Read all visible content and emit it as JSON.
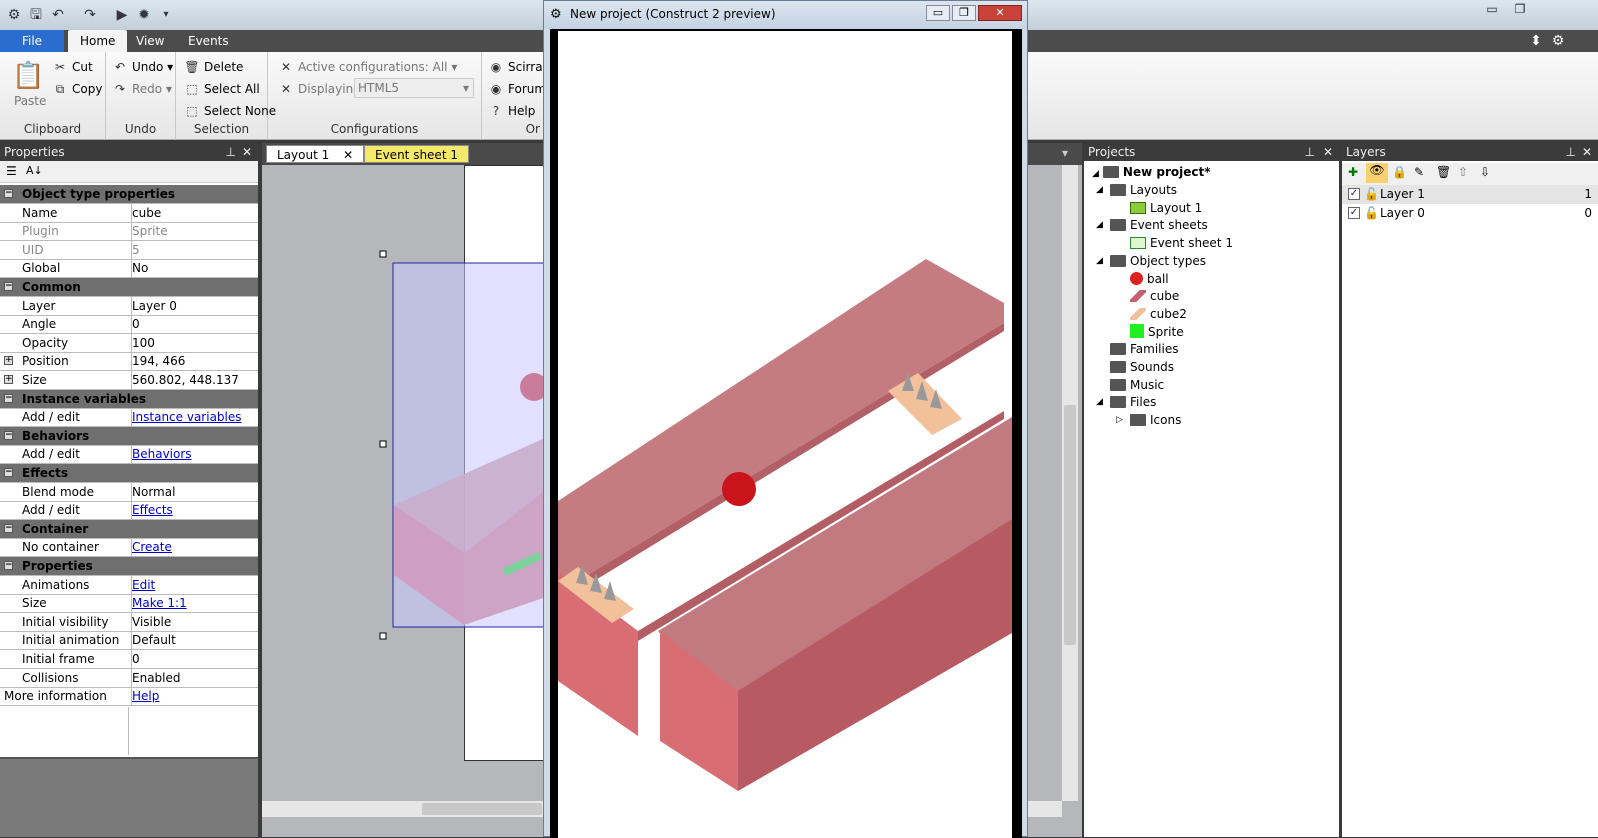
{
  "title_tabs": {
    "file": "File",
    "home": "Home",
    "view": "View",
    "events": "Events"
  },
  "ribbon": {
    "clipboard": {
      "paste": "Paste",
      "cut": "Cut",
      "copy": "Copy",
      "label": "Clipboard"
    },
    "undo": {
      "undo": "Undo",
      "redo": "Redo",
      "label": "Undo"
    },
    "selection": {
      "delete": "Delete",
      "select_all": "Select All",
      "select_none": "Select None",
      "label": "Selection"
    },
    "configurations": {
      "active": "Active configurations: All",
      "displaying": "Displaying:",
      "displaying_value": "HTML5",
      "label": "Configurations"
    },
    "online": {
      "scirra": "Scirra.c",
      "forum": "Forum",
      "help": "Help",
      "label": "Or"
    }
  },
  "properties": {
    "title": "Properties",
    "rows": [
      {
        "type": "cat",
        "key": "Object type properties"
      },
      {
        "key": "Name",
        "value": "cube"
      },
      {
        "key": "Plugin",
        "value": "Sprite",
        "muted": true
      },
      {
        "key": "UID",
        "value": "5",
        "muted": true
      },
      {
        "key": "Global",
        "value": "No"
      },
      {
        "type": "cat",
        "key": "Common"
      },
      {
        "key": "Layer",
        "value": "Layer 0"
      },
      {
        "key": "Angle",
        "value": "0"
      },
      {
        "key": "Opacity",
        "value": "100"
      },
      {
        "key": "Position",
        "value": "194, 466",
        "expand": true
      },
      {
        "key": "Size",
        "value": "560.802, 448.137",
        "expand": true
      },
      {
        "type": "cat",
        "key": "Instance variables"
      },
      {
        "key": "Add / edit",
        "value": "Instance variables",
        "link": true
      },
      {
        "type": "cat",
        "key": "Behaviors"
      },
      {
        "key": "Add / edit",
        "value": "Behaviors",
        "link": true
      },
      {
        "type": "cat",
        "key": "Effects"
      },
      {
        "key": "Blend mode",
        "value": "Normal"
      },
      {
        "key": "Add / edit",
        "value": "Effects",
        "link": true
      },
      {
        "type": "cat",
        "key": "Container"
      },
      {
        "key": "No container",
        "value": "Create",
        "link": true
      },
      {
        "type": "cat",
        "key": "Properties"
      },
      {
        "key": "Animations",
        "value": "Edit",
        "link": true
      },
      {
        "key": "Size",
        "value": "Make 1:1",
        "link": true
      },
      {
        "key": "Initial visibility",
        "value": "Visible"
      },
      {
        "key": "Initial animation",
        "value": "Default"
      },
      {
        "key": "Initial frame",
        "value": "0"
      },
      {
        "key": "Collisions",
        "value": "Enabled"
      },
      {
        "key": "More information",
        "value": "Help",
        "link": true,
        "flush": true
      }
    ]
  },
  "editor": {
    "tab1": "Layout 1",
    "tab2": "Event sheet 1"
  },
  "preview": {
    "title": "New project (Construct 2 preview)"
  },
  "projects": {
    "title": "Projects",
    "root": "New project*",
    "nodes": [
      {
        "label": "Layouts",
        "depth": 1,
        "icon": "folder",
        "expanded": true
      },
      {
        "label": "Layout 1",
        "depth": 2,
        "icon": "layout"
      },
      {
        "label": "Event sheets",
        "depth": 1,
        "icon": "folder",
        "expanded": true
      },
      {
        "label": "Event sheet 1",
        "depth": 2,
        "icon": "sheet"
      },
      {
        "label": "Object types",
        "depth": 1,
        "icon": "folder",
        "expanded": true
      },
      {
        "label": "ball",
        "depth": 2,
        "icon": "ball"
      },
      {
        "label": "cube",
        "depth": 2,
        "icon": "cube"
      },
      {
        "label": "cube2",
        "depth": 2,
        "icon": "cube2"
      },
      {
        "label": "Sprite",
        "depth": 2,
        "icon": "sprite"
      },
      {
        "label": "Families",
        "depth": 1,
        "icon": "folder"
      },
      {
        "label": "Sounds",
        "depth": 1,
        "icon": "folder"
      },
      {
        "label": "Music",
        "depth": 1,
        "icon": "folder"
      },
      {
        "label": "Files",
        "depth": 1,
        "icon": "folder",
        "expanded": true
      },
      {
        "label": "Icons",
        "depth": 2,
        "icon": "folder",
        "collapsed": true
      }
    ]
  },
  "layers": {
    "title": "Layers",
    "items": [
      {
        "name": "Layer 1",
        "index": "1",
        "checked": true
      },
      {
        "name": "Layer 0",
        "index": "0",
        "checked": true
      }
    ]
  },
  "colors": {
    "cube_top": "#c47c80",
    "cube_side": "#d76d72",
    "ball": "#c8141a",
    "spike_wood": "#f2c19c",
    "sprite_green": "#22ee22"
  }
}
